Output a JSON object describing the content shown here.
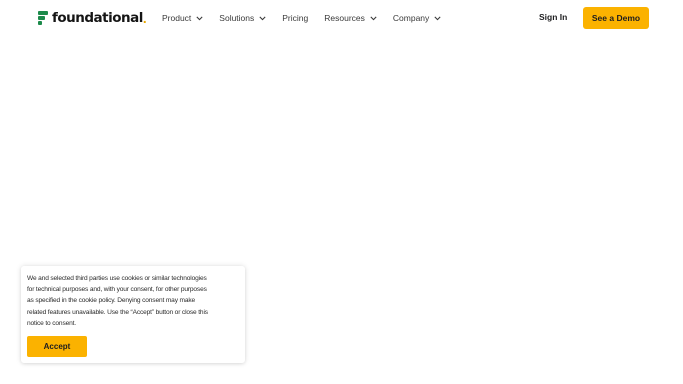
{
  "brand": {
    "name": "foundational",
    "dot": ".",
    "accent_color": "#fbb200",
    "logo_color": "#1c8a4a"
  },
  "nav": {
    "items": [
      {
        "label": "Product",
        "has_dropdown": true
      },
      {
        "label": "Solutions",
        "has_dropdown": true
      },
      {
        "label": "Pricing",
        "has_dropdown": false
      },
      {
        "label": "Resources",
        "has_dropdown": true
      },
      {
        "label": "Company",
        "has_dropdown": true
      }
    ],
    "signin_label": "Sign In",
    "demo_label": "See a Demo"
  },
  "cookie": {
    "lines": [
      "We and selected third parties use cookies or similar technologies",
      "for technical purposes and, with your consent, for other purposes",
      "as specified in the cookie policy. Denying consent may make",
      "related features unavailable. Use the “Accept” button or close this",
      "notice to consent."
    ],
    "accept_label": "Accept"
  }
}
